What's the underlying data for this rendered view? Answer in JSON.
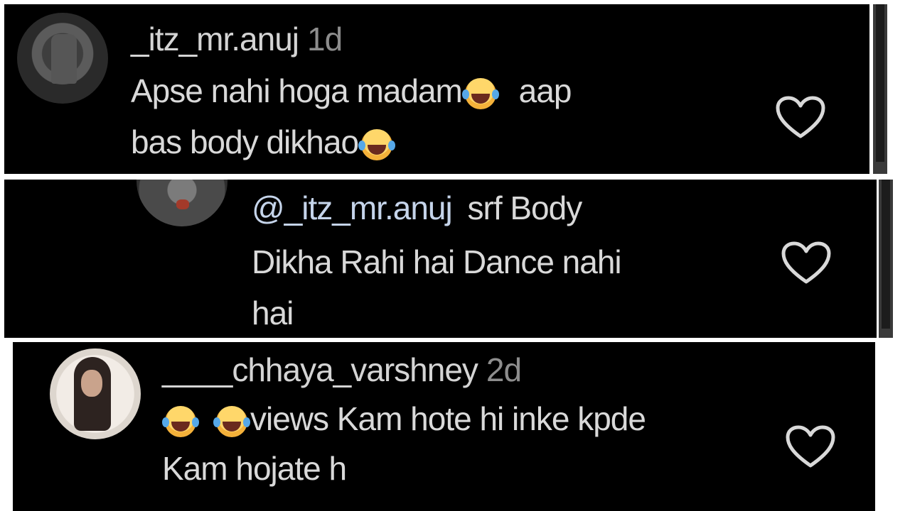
{
  "comments": [
    {
      "username": "_itz_mr.anuj",
      "time": "1d",
      "line1": "Apse nahi hoga madam",
      "line1_after": "aap",
      "line2": "bas body dikhao"
    },
    {
      "mention": "@_itz_mr.anuj",
      "line1_rest": "srf Body",
      "line2": "Dikha Rahi hai Dance nahi",
      "line3": "hai"
    },
    {
      "username": "____chhaya_varshney",
      "time": "2d",
      "line1": "views Kam hote hi inke kpde",
      "line2": "Kam hojate h"
    }
  ],
  "icons": {
    "like": "heart-outline-icon",
    "emoji": "face-with-tears-of-joy"
  },
  "colors": {
    "background": "#000000",
    "text": "#d9d9d9",
    "timestamp": "#8d8d8d",
    "mention": "#c5d4ea"
  }
}
